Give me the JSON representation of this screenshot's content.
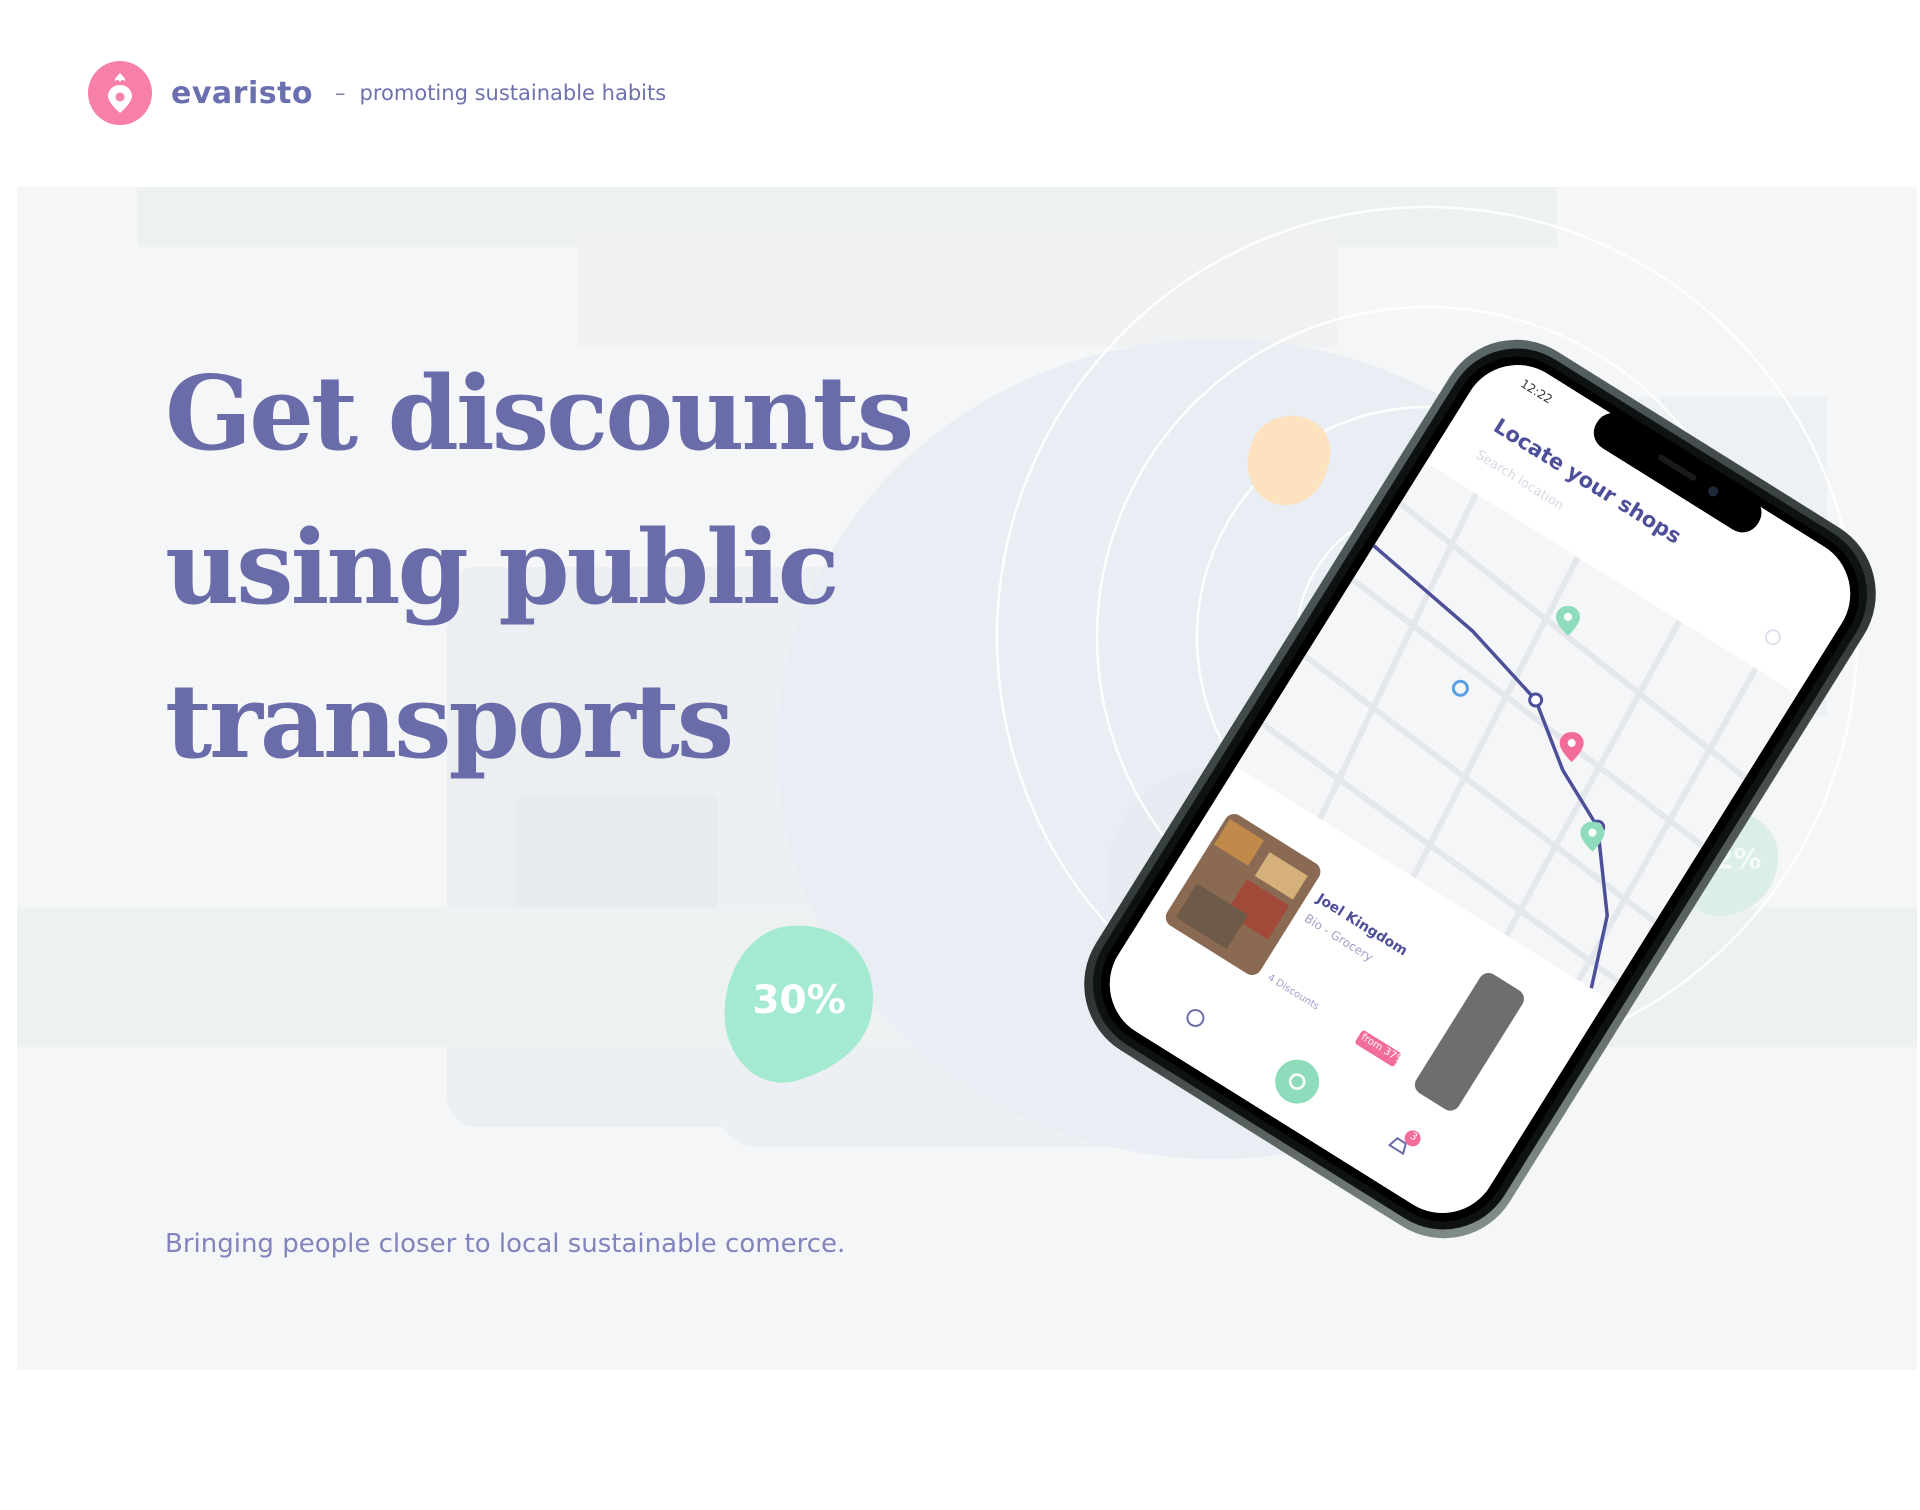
{
  "brand": {
    "name": "evaristo",
    "separator": "–",
    "tagline": "promoting sustainable habits"
  },
  "hero": {
    "headline": [
      "Get discounts",
      "using public",
      "transports"
    ],
    "subheadline": "Bringing people closer to local sustainable comerce."
  },
  "badges": {
    "primary": "30%",
    "secondary": "22%"
  },
  "phone": {
    "status_time": "12:22",
    "screen_title": "Locate your shops",
    "search_placeholder": "Search location",
    "card": {
      "shop_name": "Joel Kingdom",
      "category": "Bio - Grocery",
      "discounts": "4 Discounts",
      "tag": "from 37%"
    },
    "notification_count": "3"
  },
  "colors": {
    "brand_pink": "#f77faa",
    "brand_purple": "#6a6ba9",
    "mint": "#a3ead0",
    "peach": "#fde2c0",
    "route": "#4e4f99"
  }
}
